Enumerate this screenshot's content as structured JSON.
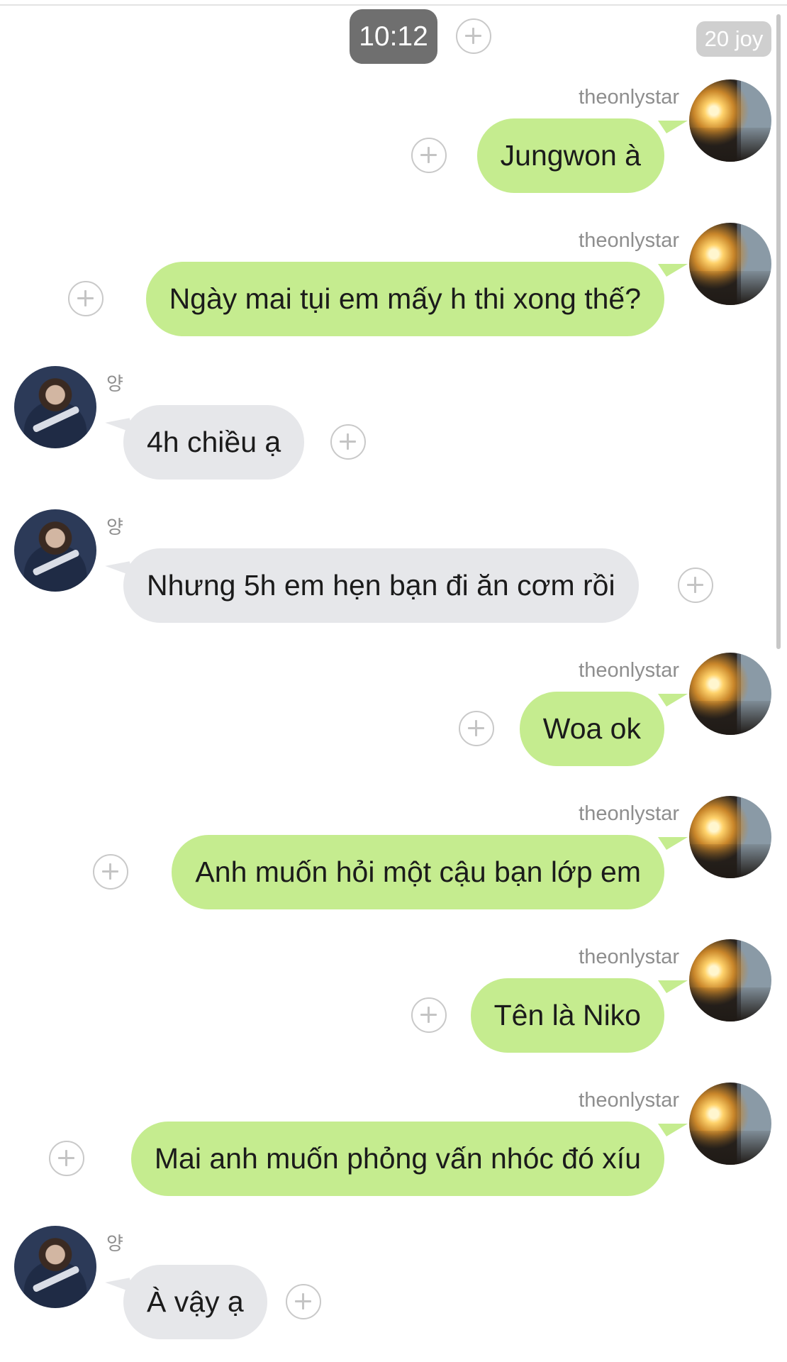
{
  "header": {
    "time": "10:12",
    "counter": "20 joy"
  },
  "messages": [
    {
      "direction": "out",
      "sender": "theonlystar",
      "text": "Jungwon à"
    },
    {
      "direction": "out",
      "sender": "theonlystar",
      "text": "Ngày mai tụi em mấy h thi xong thế?"
    },
    {
      "direction": "in",
      "sender": "양",
      "text": "4h chiều ạ"
    },
    {
      "direction": "in",
      "sender": "양",
      "text": "Nhưng 5h em hẹn bạn đi ăn cơm rồi"
    },
    {
      "direction": "out",
      "sender": "theonlystar",
      "text": "Woa ok"
    },
    {
      "direction": "out",
      "sender": "theonlystar",
      "text": "Anh muốn hỏi một cậu bạn lớp em"
    },
    {
      "direction": "out",
      "sender": "theonlystar",
      "text": "Tên là Niko"
    },
    {
      "direction": "out",
      "sender": "theonlystar",
      "text": "Mai anh muốn phỏng vấn nhóc đó xíu"
    },
    {
      "direction": "in",
      "sender": "양",
      "text": "À vậy ạ"
    }
  ],
  "colors": {
    "outgoing_bubble": "#c5ec8f",
    "incoming_bubble": "#e6e7ea",
    "time_pill": "#6f6f6f"
  }
}
